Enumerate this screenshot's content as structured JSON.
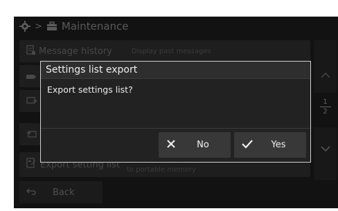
{
  "header": {
    "separator": ">",
    "title": "Maintenance"
  },
  "list": {
    "items": [
      {
        "label": "Message history",
        "description": "Display past messages"
      },
      {
        "label": "",
        "description": ""
      },
      {
        "label": "",
        "description": ""
      },
      {
        "label": "",
        "description": ""
      },
      {
        "label": "Export setting list",
        "description": "to portable memory"
      }
    ]
  },
  "pager": {
    "current": "1",
    "total": "2"
  },
  "back": {
    "label": "Back"
  },
  "dialog": {
    "title": "Settings list export",
    "message": "Export settings list?",
    "no_label": "No",
    "yes_label": "Yes"
  },
  "colors": {
    "background": "#1c1c1c",
    "dialog_border": "#d0d0d0",
    "button": "#383838"
  },
  "icons": [
    "gear-icon",
    "toolbox-icon",
    "message-history-icon",
    "card-icon",
    "export-icon",
    "import-icon",
    "document-export-icon",
    "back-arrow-icon",
    "chevron-up-icon",
    "chevron-down-icon",
    "close-icon",
    "check-icon"
  ]
}
